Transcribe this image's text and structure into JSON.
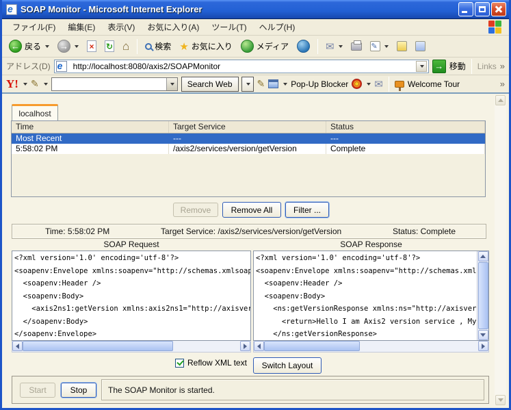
{
  "window": {
    "title": "SOAP Monitor - Microsoft Internet Explorer"
  },
  "menu": {
    "items": [
      "ファイル(F)",
      "編集(E)",
      "表示(V)",
      "お気に入り(A)",
      "ツール(T)",
      "ヘルプ(H)"
    ]
  },
  "toolbar": {
    "back_label": "戻る",
    "search_label": "検索",
    "favorites_label": "お気に入り",
    "media_label": "メディア"
  },
  "address_bar": {
    "label": "アドレス(D)",
    "url": "http://localhost:8080/axis2/SOAPMonitor",
    "go_label": "移動",
    "links_label": "Links",
    "chevron": "»"
  },
  "yahoo_bar": {
    "logo": "Y!",
    "search_button": "Search Web",
    "popup_blocker_label": "Pop-Up Blocker",
    "welcome_tour_label": "Welcome Tour",
    "chevron": "»"
  },
  "icons": {
    "back_arrow": "←",
    "forward_arrow": "→",
    "stop_x": "×",
    "refresh": "↻",
    "house": "⌂",
    "star": "★",
    "mail": "✉",
    "pencil": "✎",
    "go_arrow": "→",
    "ie_e": "e"
  },
  "applet": {
    "tab_label": "localhost",
    "table": {
      "columns": [
        "Time",
        "Target Service",
        "Status"
      ],
      "rows": [
        {
          "time": "Most Recent",
          "target": "---",
          "status": "---"
        },
        {
          "time": "5:58:02 PM",
          "target": "/axis2/services/version/getVersion",
          "status": "Complete"
        }
      ]
    },
    "buttons": {
      "remove": "Remove",
      "remove_all": "Remove All",
      "filter": "Filter ..."
    },
    "details": {
      "time": "Time: 5:58:02 PM",
      "target": "Target Service: /axis2/services/version/getVersion",
      "status": "Status: Complete"
    },
    "request": {
      "title": "SOAP Request",
      "lines": [
        "<?xml version='1.0' encoding='utf-8'?>",
        "<soapenv:Envelope xmlns:soapenv=\"http://schemas.xmlsoap.",
        "  <soapenv:Header />",
        "  <soapenv:Body>",
        "    <axis2ns1:getVersion xmlns:axis2ns1=\"http://axisvers",
        "  </soapenv:Body>",
        "</soapenv:Envelope>"
      ]
    },
    "response": {
      "title": "SOAP Response",
      "lines": [
        "<?xml version='1.0' encoding='utf-8'?>",
        "<soapenv:Envelope xmlns:soapenv=\"http://schemas.xmlsoap",
        "  <soapenv:Header />",
        "  <soapenv:Body>",
        "    <ns:getVersionResponse xmlns:ns=\"http://axisversion",
        "      <return>Hello I am Axis2 version service , My ver",
        "    </ns:getVersionResponse>",
        "  </soapenv:Body>"
      ]
    },
    "reflow_label": "Reflow XML text",
    "switch_layout_label": "Switch Layout",
    "start_label": "Start",
    "stop_label": "Stop",
    "status_message": "The SOAP Monitor is started."
  },
  "colors": {
    "titlebar_blue": "#2260d4",
    "selection_blue": "#316ac5",
    "tab_orange": "#f79b2e",
    "go_green": "#2f9e31",
    "page_bg": "#f6f3e5"
  }
}
